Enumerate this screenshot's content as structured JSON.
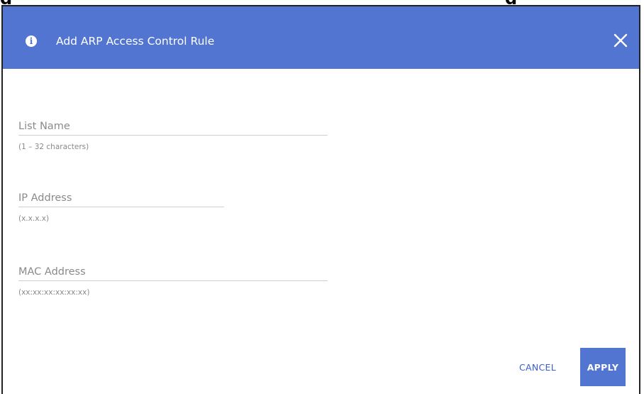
{
  "dialog": {
    "title": "Add ARP Access Control Rule",
    "info_icon": "info-circle-icon",
    "close_icon": "close-x-icon",
    "header_color": "#5275d1"
  },
  "form": {
    "list_name": {
      "placeholder": "List Name",
      "value": "",
      "hint": "(1 – 32 characters)"
    },
    "ip_address": {
      "placeholder": "IP Address",
      "value": "",
      "hint": "(x.x.x.x)"
    },
    "mac_address": {
      "placeholder": "MAC Address",
      "value": "",
      "hint": "(xx:xx:xx:xx:xx:xx)"
    }
  },
  "actions": {
    "cancel_label": "CANCEL",
    "apply_label": "APPLY",
    "accent_color": "#5275d1"
  }
}
